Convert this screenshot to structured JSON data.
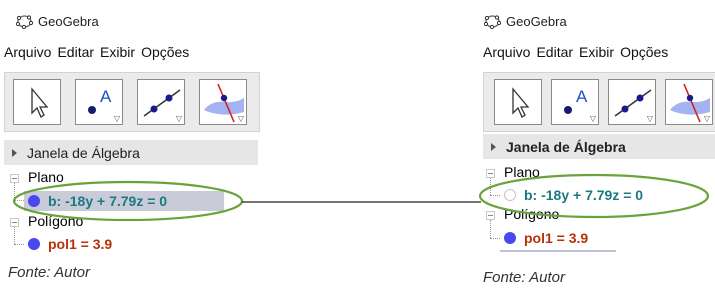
{
  "left_panel": {
    "window_title": "GeoGebra",
    "menu": [
      "Arquivo",
      "Editar",
      "Exibir",
      "Opções"
    ],
    "algebra_header": "Janela de Álgebra",
    "groups": [
      {
        "label": "Plano",
        "object": "b: -18y + 7.79z = 0",
        "visible": true,
        "selected": true
      },
      {
        "label": "Polígono",
        "object": "pol1 = 3.9",
        "visible": true,
        "selected": false
      }
    ],
    "caption": "Fonte: Autor"
  },
  "right_panel": {
    "window_title": "GeoGebra",
    "menu": [
      "Arquivo",
      "Editar",
      "Exibir",
      "Opções"
    ],
    "algebra_header": "Janela de Álgebra",
    "groups": [
      {
        "label": "Plano",
        "object": "b: -18y + 7.79z = 0",
        "visible": false,
        "selected": false
      },
      {
        "label": "Polígono",
        "object": "pol1 = 3.9",
        "visible": true,
        "selected": false
      }
    ],
    "caption": "Fonte: Autor"
  },
  "colors": {
    "highlight_ellipse": "#6aa33a",
    "plane_text": "#1a7a80",
    "polygon_text": "#b5320a",
    "object_dot": "#4848ee",
    "selection": "#c9cbd8"
  },
  "toolbar_icons": [
    "cursor-arrow-icon",
    "point-tool-icon",
    "line-tool-icon",
    "perpendicular-line-tool-icon"
  ]
}
